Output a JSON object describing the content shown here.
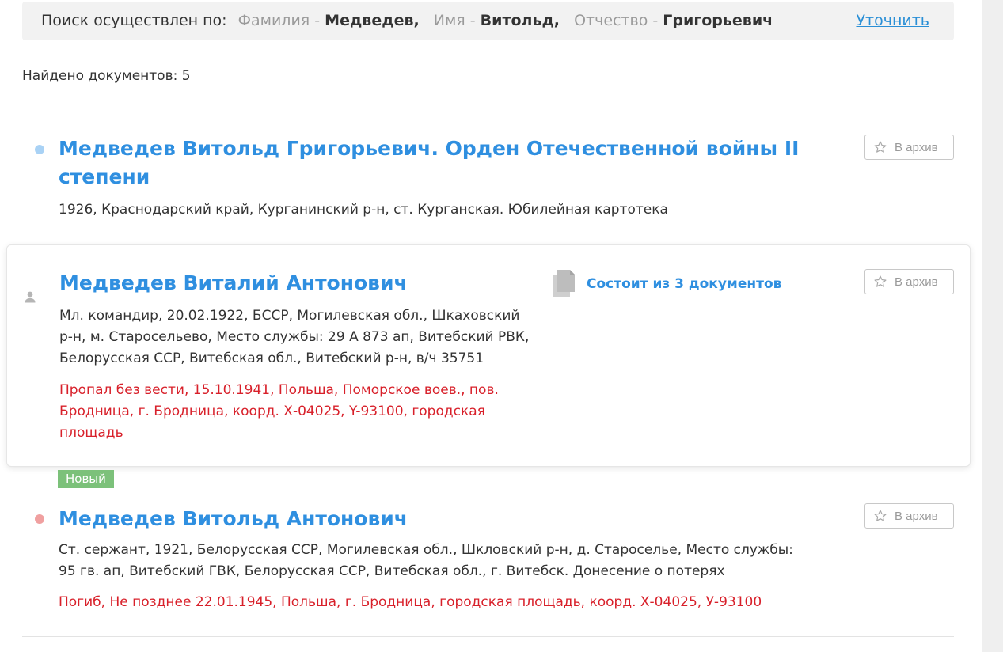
{
  "search": {
    "prefix": "Поиск осуществлен по:",
    "surname_label": "Фамилия -",
    "surname_value": "Медведев,",
    "name_label": "Имя -",
    "name_value": "Витольд,",
    "patronymic_label": "Отчество -",
    "patronymic_value": "Григорьевич",
    "refine_label": "Уточнить"
  },
  "found_count_text": "Найдено документов: 5",
  "archive_label": "В архив",
  "results": [
    {
      "title_line1": "Медведев Витольд Григорьевич. Орден Отечественной войны II",
      "title_line2": "степени",
      "desc": "1926, Краснодарский край, Курганинский р-н, ст. Курганская. Юбилейная картотека",
      "marker_color": "#a9d2f5"
    },
    {
      "title_line1": "Медведев Виталий Антонович",
      "desc_lines": [
        "Мл. командир, 20.02.1922, БССР, Могилевская обл., Шкаховский",
        "р-н, м. Старосельево, Место службы: 29 А 873 ап, Витебский РВК,",
        "Белорусская ССР, Витебская обл., Витебский р-н, в/ч 35751"
      ],
      "status_lines": [
        "Пропал без вести, 15.10.1941, Польша, Поморское воев., пов.",
        "Бродница, г. Бродница, коорд. Х-04025, Y-93100, городская",
        "площадь"
      ],
      "docs_label": "Состоит из 3 документов"
    },
    {
      "badge": "Новый",
      "title_line1": "Медведев Витольд Антонович",
      "desc_lines": [
        "Ст. сержант, 1921, Белорусская ССР, Могилевская обл., Шкловский р-н, д. Староселье, Место службы:",
        "95 гв. ап, Витебский ГВК, Белорусская ССР, Витебская обл., г. Витебск. Донесение о потерях"
      ],
      "status_lines": [
        "Погиб, Не позднее 22.01.1945, Польша, г. Бродница, городская площадь, коорд. Х-04025, У-93100"
      ],
      "marker_color": "#f0a0a0"
    }
  ],
  "colors": {
    "link_blue": "#2f8fe0",
    "status_red": "#d8202a",
    "badge_green": "#7cc17a"
  }
}
